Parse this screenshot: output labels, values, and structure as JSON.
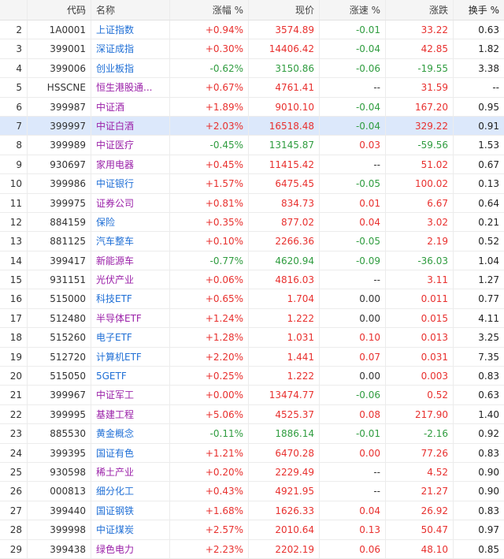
{
  "headers": {
    "idx": "",
    "code": "代码",
    "name": "名称",
    "pct": "涨幅 %",
    "price": "现价",
    "speed": "涨速 %",
    "change": "涨跌",
    "turnover": "换手 %"
  },
  "selected_index": 5,
  "colors": {
    "up": "#e8302e",
    "down": "#2f9c3f",
    "name_blue": "#1f6fd6",
    "name_purple": "#9a1fa8",
    "selected_bg": "#dce8fb"
  },
  "rows": [
    {
      "idx": "2",
      "code": "1A0001",
      "name": "上证指数",
      "pct": "+0.94%",
      "price": "3574.89",
      "speed": "-0.01",
      "change": "33.22",
      "turnover": "0.63",
      "dir": "up",
      "sdir": "down",
      "nc": "blue"
    },
    {
      "idx": "3",
      "code": "399001",
      "name": "深证成指",
      "pct": "+0.30%",
      "price": "14406.42",
      "speed": "-0.04",
      "change": "42.85",
      "turnover": "1.82",
      "dir": "up",
      "sdir": "down",
      "nc": "blue"
    },
    {
      "idx": "4",
      "code": "399006",
      "name": "创业板指",
      "pct": "-0.62%",
      "price": "3150.86",
      "speed": "-0.06",
      "change": "-19.55",
      "turnover": "3.38",
      "dir": "down",
      "sdir": "down",
      "nc": "blue"
    },
    {
      "idx": "5",
      "code": "HSSCNE",
      "name": "恒生港股通...",
      "pct": "+0.67%",
      "price": "4761.41",
      "speed": "--",
      "change": "31.59",
      "turnover": "--",
      "dir": "up",
      "sdir": "flat",
      "nc": "purple"
    },
    {
      "idx": "6",
      "code": "399987",
      "name": "中证酒",
      "pct": "+1.89%",
      "price": "9010.10",
      "speed": "-0.04",
      "change": "167.20",
      "turnover": "0.95",
      "dir": "up",
      "sdir": "down",
      "nc": "purple"
    },
    {
      "idx": "7",
      "code": "399997",
      "name": "中证白酒",
      "pct": "+2.03%",
      "price": "16518.48",
      "speed": "-0.04",
      "change": "329.22",
      "turnover": "0.91",
      "dir": "up",
      "sdir": "down",
      "nc": "purple"
    },
    {
      "idx": "8",
      "code": "399989",
      "name": "中证医疗",
      "pct": "-0.45%",
      "price": "13145.87",
      "speed": "0.03",
      "change": "-59.56",
      "turnover": "1.53",
      "dir": "down",
      "sdir": "up",
      "nc": "purple"
    },
    {
      "idx": "9",
      "code": "930697",
      "name": "家用电器",
      "pct": "+0.45%",
      "price": "11415.42",
      "speed": "--",
      "change": "51.02",
      "turnover": "0.67",
      "dir": "up",
      "sdir": "flat",
      "nc": "purple"
    },
    {
      "idx": "10",
      "code": "399986",
      "name": "中证银行",
      "pct": "+1.57%",
      "price": "6475.45",
      "speed": "-0.05",
      "change": "100.02",
      "turnover": "0.13",
      "dir": "up",
      "sdir": "down",
      "nc": "blue"
    },
    {
      "idx": "11",
      "code": "399975",
      "name": "证券公司",
      "pct": "+0.81%",
      "price": "834.73",
      "speed": "0.01",
      "change": "6.67",
      "turnover": "0.64",
      "dir": "up",
      "sdir": "up",
      "nc": "purple"
    },
    {
      "idx": "12",
      "code": "884159",
      "name": "保险",
      "pct": "+0.35%",
      "price": "877.02",
      "speed": "0.04",
      "change": "3.02",
      "turnover": "0.21",
      "dir": "up",
      "sdir": "up",
      "nc": "blue"
    },
    {
      "idx": "13",
      "code": "881125",
      "name": "汽车整车",
      "pct": "+0.10%",
      "price": "2266.36",
      "speed": "-0.05",
      "change": "2.19",
      "turnover": "0.52",
      "dir": "up",
      "sdir": "down",
      "nc": "blue"
    },
    {
      "idx": "14",
      "code": "399417",
      "name": "新能源车",
      "pct": "-0.77%",
      "price": "4620.94",
      "speed": "-0.09",
      "change": "-36.03",
      "turnover": "1.04",
      "dir": "down",
      "sdir": "down",
      "nc": "purple"
    },
    {
      "idx": "15",
      "code": "931151",
      "name": "光伏产业",
      "pct": "+0.06%",
      "price": "4816.03",
      "speed": "--",
      "change": "3.11",
      "turnover": "1.27",
      "dir": "up",
      "sdir": "flat",
      "nc": "purple"
    },
    {
      "idx": "16",
      "code": "515000",
      "name": "科技ETF",
      "pct": "+0.65%",
      "price": "1.704",
      "speed": "0.00",
      "change": "0.011",
      "turnover": "0.77",
      "dir": "up",
      "sdir": "flat",
      "nc": "blue"
    },
    {
      "idx": "17",
      "code": "512480",
      "name": "半导体ETF",
      "pct": "+1.24%",
      "price": "1.222",
      "speed": "0.00",
      "change": "0.015",
      "turnover": "4.11",
      "dir": "up",
      "sdir": "flat",
      "nc": "purple"
    },
    {
      "idx": "18",
      "code": "515260",
      "name": "电子ETF",
      "pct": "+1.28%",
      "price": "1.031",
      "speed": "0.10",
      "change": "0.013",
      "turnover": "3.25",
      "dir": "up",
      "sdir": "up",
      "nc": "blue"
    },
    {
      "idx": "19",
      "code": "512720",
      "name": "计算机ETF",
      "pct": "+2.20%",
      "price": "1.441",
      "speed": "0.07",
      "change": "0.031",
      "turnover": "7.35",
      "dir": "up",
      "sdir": "up",
      "nc": "blue"
    },
    {
      "idx": "20",
      "code": "515050",
      "name": "5GETF",
      "pct": "+0.25%",
      "price": "1.222",
      "speed": "0.00",
      "change": "0.003",
      "turnover": "0.83",
      "dir": "up",
      "sdir": "flat",
      "nc": "blue"
    },
    {
      "idx": "21",
      "code": "399967",
      "name": "中证军工",
      "pct": "+0.00%",
      "price": "13474.77",
      "speed": "-0.06",
      "change": "0.52",
      "turnover": "0.63",
      "dir": "up",
      "sdir": "down",
      "nc": "purple"
    },
    {
      "idx": "22",
      "code": "399995",
      "name": "基建工程",
      "pct": "+5.06%",
      "price": "4525.37",
      "speed": "0.08",
      "change": "217.90",
      "turnover": "1.40",
      "dir": "up",
      "sdir": "up",
      "nc": "purple"
    },
    {
      "idx": "23",
      "code": "885530",
      "name": "黄金概念",
      "pct": "-0.11%",
      "price": "1886.14",
      "speed": "-0.01",
      "change": "-2.16",
      "turnover": "0.92",
      "dir": "down",
      "sdir": "down",
      "nc": "blue"
    },
    {
      "idx": "24",
      "code": "399395",
      "name": "国证有色",
      "pct": "+1.21%",
      "price": "6470.28",
      "speed": "0.00",
      "change": "77.26",
      "turnover": "0.83",
      "dir": "up",
      "sdir": "up",
      "nc": "blue"
    },
    {
      "idx": "25",
      "code": "930598",
      "name": "稀土产业",
      "pct": "+0.20%",
      "price": "2229.49",
      "speed": "--",
      "change": "4.52",
      "turnover": "0.90",
      "dir": "up",
      "sdir": "flat",
      "nc": "purple"
    },
    {
      "idx": "26",
      "code": "000813",
      "name": "细分化工",
      "pct": "+0.43%",
      "price": "4921.95",
      "speed": "--",
      "change": "21.27",
      "turnover": "0.90",
      "dir": "up",
      "sdir": "flat",
      "nc": "blue"
    },
    {
      "idx": "27",
      "code": "399440",
      "name": "国证钢铁",
      "pct": "+1.68%",
      "price": "1626.33",
      "speed": "0.04",
      "change": "26.92",
      "turnover": "0.83",
      "dir": "up",
      "sdir": "up",
      "nc": "blue"
    },
    {
      "idx": "28",
      "code": "399998",
      "name": "中证煤炭",
      "pct": "+2.57%",
      "price": "2010.64",
      "speed": "0.13",
      "change": "50.47",
      "turnover": "0.97",
      "dir": "up",
      "sdir": "up",
      "nc": "blue"
    },
    {
      "idx": "29",
      "code": "399438",
      "name": "绿色电力",
      "pct": "+2.23%",
      "price": "2202.19",
      "speed": "0.06",
      "change": "48.10",
      "turnover": "0.85",
      "dir": "up",
      "sdir": "up",
      "nc": "purple"
    }
  ]
}
